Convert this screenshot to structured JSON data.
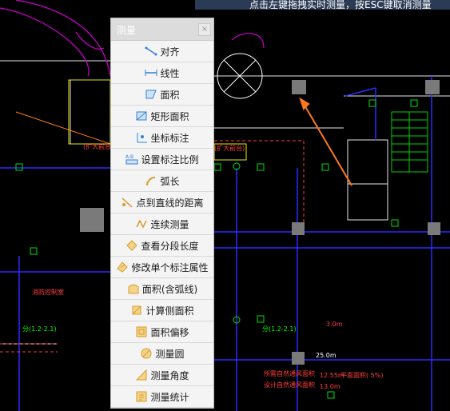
{
  "topbar": {
    "text": "点击左键拖拽实时测量，按ESC键取消测量"
  },
  "panel": {
    "title": "测量",
    "close_label": "×",
    "items": [
      {
        "label": "对齐",
        "icon": "align-icon"
      },
      {
        "label": "线性",
        "icon": "linear-dimension-icon"
      },
      {
        "label": "面积",
        "icon": "area-icon"
      },
      {
        "label": "矩形面积",
        "icon": "rect-area-icon"
      },
      {
        "label": "坐标标注",
        "icon": "coordinate-icon"
      },
      {
        "label": "设置标注比例",
        "icon": "scale-icon"
      },
      {
        "label": "弧长",
        "icon": "arc-length-icon"
      },
      {
        "label": "点到直线的距离",
        "icon": "point-line-distance-icon"
      },
      {
        "label": "连续测量",
        "icon": "continuous-measure-icon"
      },
      {
        "label": "查看分段长度",
        "icon": "segment-length-icon"
      },
      {
        "label": "修改单个标注属性",
        "icon": "edit-dimension-icon"
      },
      {
        "label": "面积(含弧线)",
        "icon": "arc-area-icon"
      },
      {
        "label": "计算侧面积",
        "icon": "side-area-icon"
      },
      {
        "label": "面积偏移",
        "icon": "area-offset-icon"
      },
      {
        "label": "测量圆",
        "icon": "measure-circle-icon"
      },
      {
        "label": "测量角度",
        "icon": "measure-angle-icon"
      },
      {
        "label": "测量统计",
        "icon": "measure-stats-icon"
      }
    ]
  },
  "cad": {
    "labels": {
      "left_room": "(扩大前台",
      "center_room": "(扩大前台)",
      "control_room": "消防控制室",
      "mark1": "分(1.2-2.1)",
      "mark2": "分(1.2-2.1)",
      "dim1": "3.0m",
      "dim2": "25.0m",
      "note1": "所需自然通风面积",
      "note2": "设计自然通风面积",
      "val1": "12.55m",
      "val2": "13.0m",
      "ratio": "平面面积(  5%)"
    }
  }
}
